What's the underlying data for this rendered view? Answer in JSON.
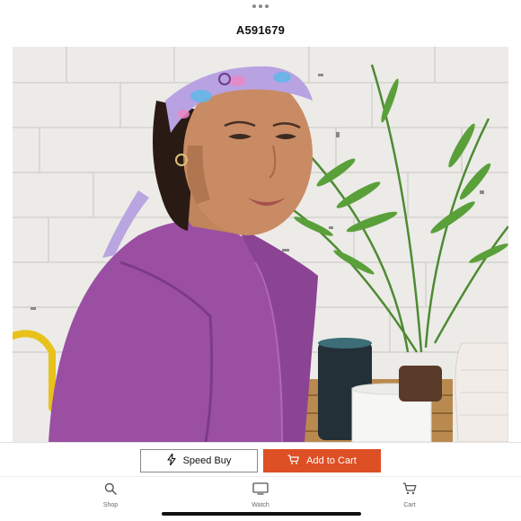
{
  "header": {
    "product_code": "A591679"
  },
  "image": {
    "subject": "product-photo-woman-headband"
  },
  "actions": {
    "speed_buy_label": "Speed Buy",
    "speed_buy_icon": "lightning-icon",
    "add_to_cart_label": "Add to Cart",
    "add_to_cart_icon": "cart-icon",
    "accent_color": "#dd4f25"
  },
  "tabs": [
    {
      "label": "Shop",
      "icon": "search-icon"
    },
    {
      "label": "Watch",
      "icon": "tv-icon"
    },
    {
      "label": "Cart",
      "icon": "cart-icon"
    }
  ]
}
